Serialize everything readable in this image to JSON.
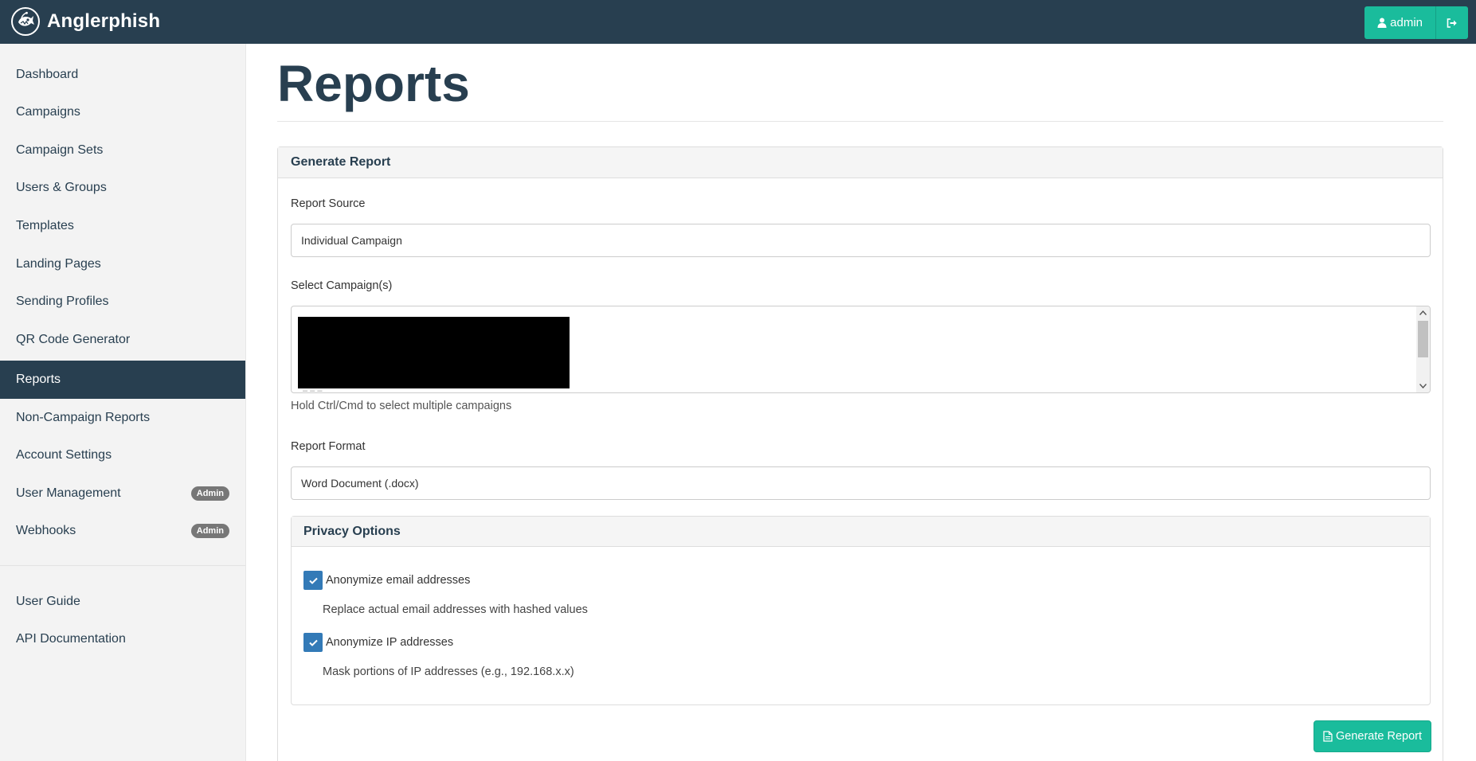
{
  "app": {
    "name": "Anglerphish"
  },
  "header": {
    "user_label": "admin"
  },
  "sidebar": {
    "items": [
      {
        "label": "Dashboard"
      },
      {
        "label": "Campaigns"
      },
      {
        "label": "Campaign Sets"
      },
      {
        "label": "Users & Groups"
      },
      {
        "label": "Templates"
      },
      {
        "label": "Landing Pages"
      },
      {
        "label": "Sending Profiles"
      },
      {
        "label": "QR Code Generator"
      },
      {
        "label": "Reports",
        "active": true
      },
      {
        "label": "Non-Campaign Reports"
      },
      {
        "label": "Account Settings"
      },
      {
        "label": "User Management",
        "badge": "Admin"
      },
      {
        "label": "Webhooks",
        "badge": "Admin"
      }
    ],
    "footer_items": [
      {
        "label": "User Guide"
      },
      {
        "label": "API Documentation"
      }
    ]
  },
  "main": {
    "title": "Reports",
    "panel_title": "Generate Report",
    "report_source": {
      "label": "Report Source",
      "value": "Individual Campaign"
    },
    "campaigns": {
      "label": "Select Campaign(s)",
      "help": "Hold Ctrl/Cmd to select multiple campaigns"
    },
    "report_format": {
      "label": "Report Format",
      "value": "Word Document (.docx)"
    },
    "privacy": {
      "title": "Privacy Options",
      "email": {
        "label": "Anonymize email addresses",
        "description": "Replace actual email addresses with hashed values",
        "checked": true
      },
      "ip": {
        "label": "Anonymize IP addresses",
        "description": "Mask portions of IP addresses (e.g., 192.168.x.x)",
        "checked": true
      }
    },
    "generate_button": "Generate Report"
  },
  "colors": {
    "navbar": "#283f50",
    "accent": "#1abc9c",
    "checkbox": "#337ab7",
    "sidebar_bg": "#f3f3f3",
    "badge": "#777777"
  }
}
